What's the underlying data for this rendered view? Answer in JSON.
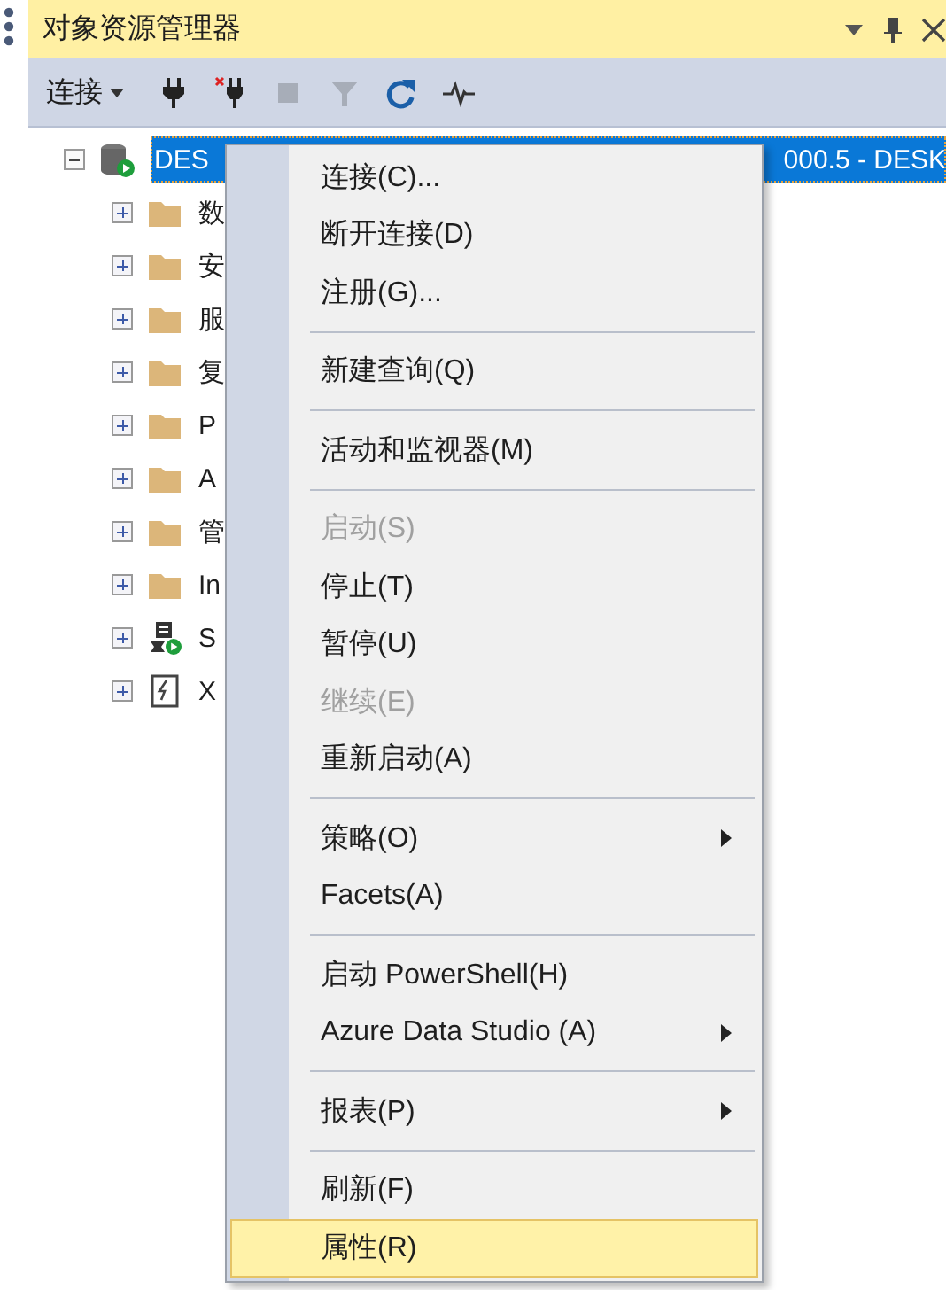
{
  "panel": {
    "title": "对象资源管理器"
  },
  "toolbar": {
    "connect_label": "连接",
    "buttons": [
      {
        "kind": "plug",
        "disabled": false
      },
      {
        "kind": "unplug",
        "disabled": false
      },
      {
        "kind": "stop",
        "disabled": true
      },
      {
        "kind": "filter",
        "disabled": true
      },
      {
        "kind": "refresh",
        "disabled": false
      },
      {
        "kind": "activity",
        "disabled": false
      }
    ]
  },
  "tree": [
    {
      "kind": "server",
      "label": "DES",
      "label_end": "000.5 - DESK",
      "expanded": true,
      "selected": true,
      "children": [
        {
          "kind": "folder",
          "label": "数",
          "expanded": false
        },
        {
          "kind": "folder",
          "label": "安",
          "expanded": false
        },
        {
          "kind": "folder",
          "label": "服",
          "expanded": false
        },
        {
          "kind": "folder",
          "label": "复",
          "expanded": false
        },
        {
          "kind": "folder",
          "label": "P",
          "expanded": false
        },
        {
          "kind": "folder",
          "label": "A",
          "expanded": false
        },
        {
          "kind": "folder",
          "label": "管",
          "expanded": false
        },
        {
          "kind": "folder",
          "label": "In",
          "expanded": false
        },
        {
          "kind": "agent",
          "label": "S",
          "expanded": false
        },
        {
          "kind": "xevent",
          "label": "X",
          "expanded": false
        }
      ]
    }
  ],
  "context_menu": [
    {
      "kind": "item",
      "label": "连接(C)...",
      "disabled": false,
      "submenu": false,
      "selected": false
    },
    {
      "kind": "item",
      "label": "断开连接(D)",
      "disabled": false,
      "submenu": false,
      "selected": false
    },
    {
      "kind": "item",
      "label": "注册(G)...",
      "disabled": false,
      "submenu": false,
      "selected": false
    },
    {
      "kind": "separator"
    },
    {
      "kind": "item",
      "label": "新建查询(Q)",
      "disabled": false,
      "submenu": false,
      "selected": false
    },
    {
      "kind": "separator"
    },
    {
      "kind": "item",
      "label": "活动和监视器(M)",
      "disabled": false,
      "submenu": false,
      "selected": false
    },
    {
      "kind": "separator"
    },
    {
      "kind": "item",
      "label": "启动(S)",
      "disabled": true,
      "submenu": false,
      "selected": false
    },
    {
      "kind": "item",
      "label": "停止(T)",
      "disabled": false,
      "submenu": false,
      "selected": false
    },
    {
      "kind": "item",
      "label": "暂停(U)",
      "disabled": false,
      "submenu": false,
      "selected": false
    },
    {
      "kind": "item",
      "label": "继续(E)",
      "disabled": true,
      "submenu": false,
      "selected": false
    },
    {
      "kind": "item",
      "label": "重新启动(A)",
      "disabled": false,
      "submenu": false,
      "selected": false
    },
    {
      "kind": "separator"
    },
    {
      "kind": "item",
      "label": "策略(O)",
      "disabled": false,
      "submenu": true,
      "selected": false
    },
    {
      "kind": "item",
      "label": "Facets(A)",
      "disabled": false,
      "submenu": false,
      "selected": false
    },
    {
      "kind": "separator"
    },
    {
      "kind": "item",
      "label": "启动 PowerShell(H)",
      "disabled": false,
      "submenu": false,
      "selected": false
    },
    {
      "kind": "item",
      "label": "Azure Data Studio (A)",
      "disabled": false,
      "submenu": true,
      "selected": false
    },
    {
      "kind": "separator"
    },
    {
      "kind": "item",
      "label": "报表(P)",
      "disabled": false,
      "submenu": true,
      "selected": false
    },
    {
      "kind": "separator"
    },
    {
      "kind": "item",
      "label": "刷新(F)",
      "disabled": false,
      "submenu": false,
      "selected": false
    },
    {
      "kind": "item",
      "label": "属性(R)",
      "disabled": false,
      "submenu": false,
      "selected": true
    }
  ]
}
